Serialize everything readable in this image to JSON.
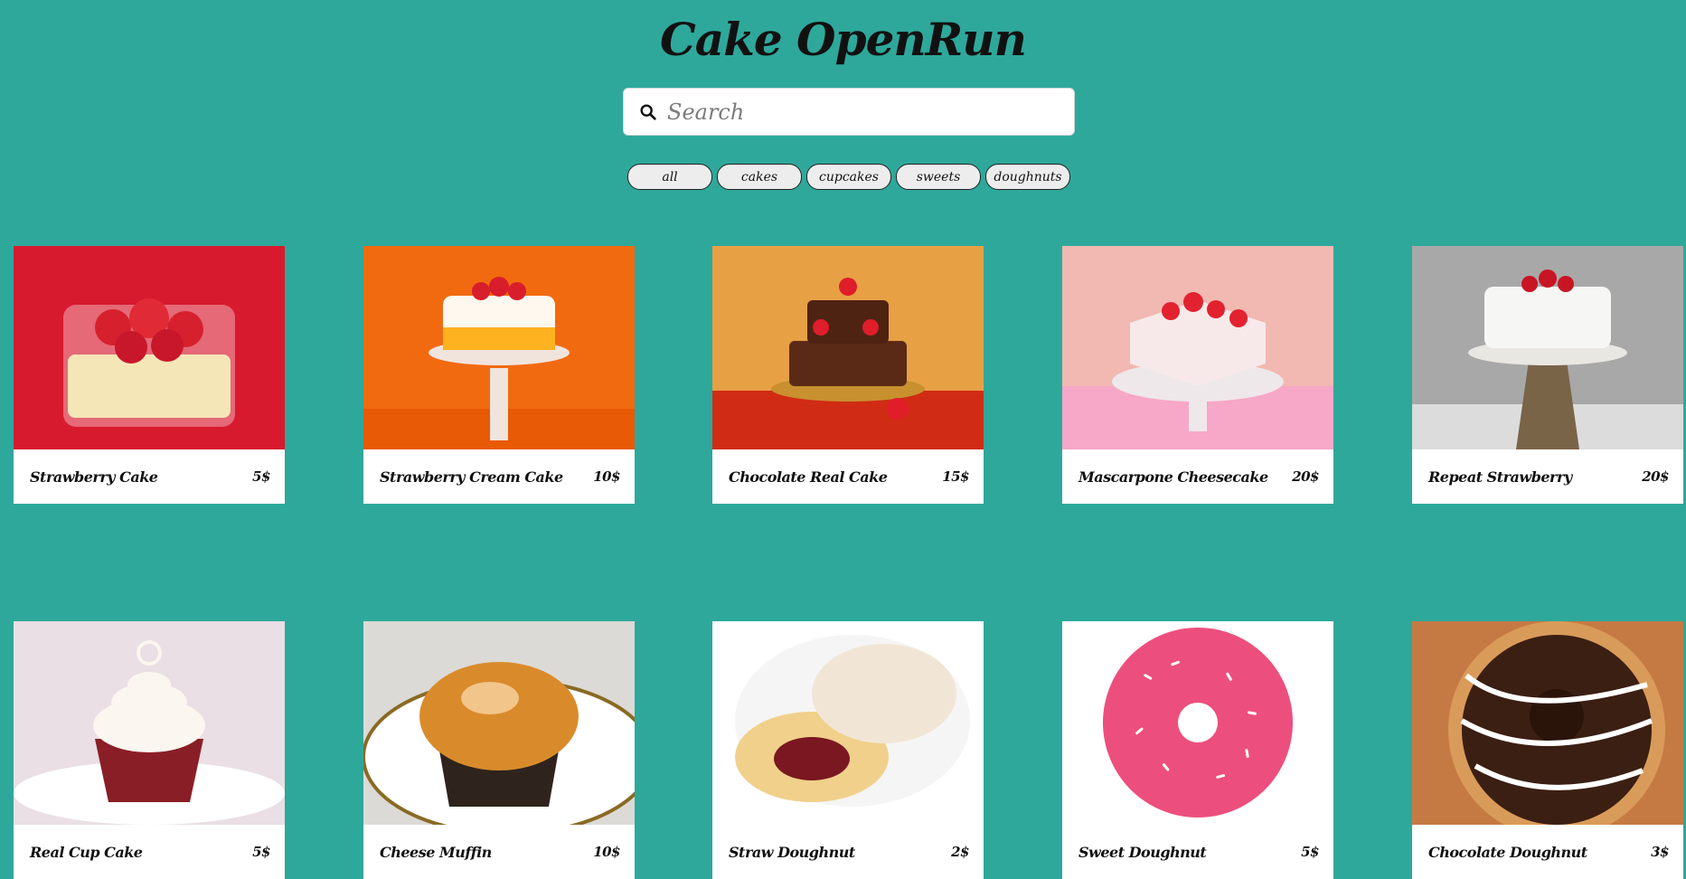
{
  "header": {
    "title": "Cake OpenRun"
  },
  "search": {
    "placeholder": "Search",
    "icon": "search-icon"
  },
  "filters": [
    "all",
    "cakes",
    "cupcakes",
    "sweets",
    "doughnuts"
  ],
  "products": [
    {
      "name": "Strawberry Cake",
      "price": "5$",
      "bg": "#d81a2e",
      "accent": "#f5e6b8"
    },
    {
      "name": "Strawberry Cream Cake",
      "price": "10$",
      "bg": "#f26a10",
      "accent": "#fff4e6"
    },
    {
      "name": "Chocolate Real Cake",
      "price": "15$",
      "bg": "#e8a045",
      "accent": "#5a2a16"
    },
    {
      "name": "Mascarpone Cheesecake",
      "price": "20$",
      "bg": "#f2b8b2",
      "accent": "#f7e9ea"
    },
    {
      "name": "Repeat Strawberry",
      "price": "20$",
      "bg": "#a8a8a8",
      "accent": "#f6f6f4"
    },
    {
      "name": "Real Cup Cake",
      "price": "5$",
      "bg": "#e9dfe4",
      "accent": "#8a1e26"
    },
    {
      "name": "Cheese Muffin",
      "price": "10$",
      "bg": "#dcdad6",
      "accent": "#d98b2c"
    },
    {
      "name": "Straw Doughnut",
      "price": "2$",
      "bg": "#ffffff",
      "accent": "#f1e6d6"
    },
    {
      "name": "Sweet Doughnut",
      "price": "5$",
      "bg": "#ffffff",
      "accent": "#ec4f7d"
    },
    {
      "name": "Chocolate Doughnut",
      "price": "3$",
      "bg": "#c57a43",
      "accent": "#3b1f12"
    }
  ]
}
